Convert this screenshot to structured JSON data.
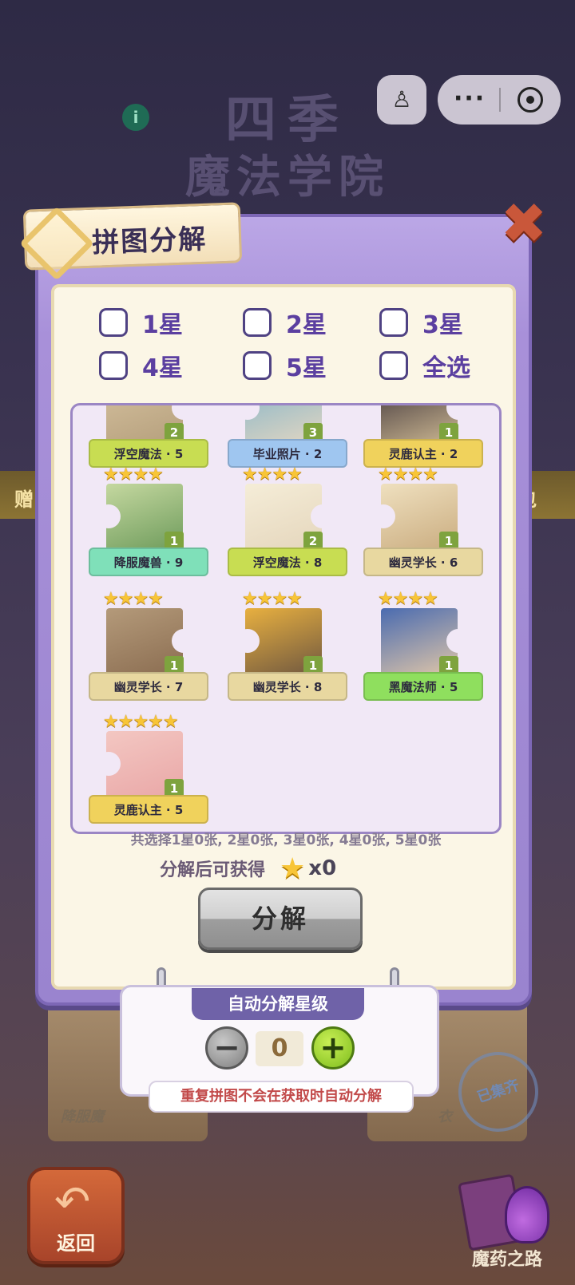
{
  "background": {
    "title_line1": "四季",
    "title_line2": "魔法学院",
    "info_icon": "i",
    "band_left": "赠",
    "band_right": "包",
    "card_left_label": "降服魔",
    "card_right_label": "衣",
    "stamp": "已集齐",
    "back_label": "返回",
    "potion_label": "魔药之路"
  },
  "dialog": {
    "title": "拼图分解",
    "close_icon": "close-icon"
  },
  "filters": [
    {
      "label": "1星"
    },
    {
      "label": "2星"
    },
    {
      "label": "3星"
    },
    {
      "label": "4星"
    },
    {
      "label": "5星"
    },
    {
      "label": "全选"
    }
  ],
  "pieces": [
    {
      "name": "浮空魔法 · 5",
      "stars": 4,
      "count": 2,
      "ribbon": "#c8dd52"
    },
    {
      "name": "毕业照片 · 2",
      "stars": 4,
      "count": 3,
      "ribbon": "#9fc6f0"
    },
    {
      "name": "灵鹿认主 · 2",
      "stars": 4,
      "count": 1,
      "ribbon": "#f0d25c"
    },
    {
      "name": "降服魔兽 · 9",
      "stars": 4,
      "count": 1,
      "ribbon": "#7fe0b9"
    },
    {
      "name": "浮空魔法 · 8",
      "stars": 4,
      "count": 2,
      "ribbon": "#c8dd52"
    },
    {
      "name": "幽灵学长 · 6",
      "stars": 4,
      "count": 1,
      "ribbon": "#e8d8a0"
    },
    {
      "name": "幽灵学长 · 7",
      "stars": 4,
      "count": 1,
      "ribbon": "#e8d8a0"
    },
    {
      "name": "幽灵学长 · 8",
      "stars": 4,
      "count": 1,
      "ribbon": "#e8d8a0"
    },
    {
      "name": "黑魔法师 · 5",
      "stars": 4,
      "count": 1,
      "ribbon": "#8fdf5e"
    },
    {
      "name": "灵鹿认主 · 5",
      "stars": 5,
      "count": 1,
      "ribbon": "#f0d25c"
    }
  ],
  "summary": {
    "text": "共选择1星0张, 2星0张, 3星0张, 4星0张, 5星0张",
    "reward_label": "分解后可获得",
    "reward_amount": "x0"
  },
  "decompose_button": "分解",
  "auto": {
    "title": "自动分解星级",
    "value": "0",
    "tip": "重复拼图不会在获取时自动分解"
  },
  "capsule": {
    "more": "···"
  }
}
